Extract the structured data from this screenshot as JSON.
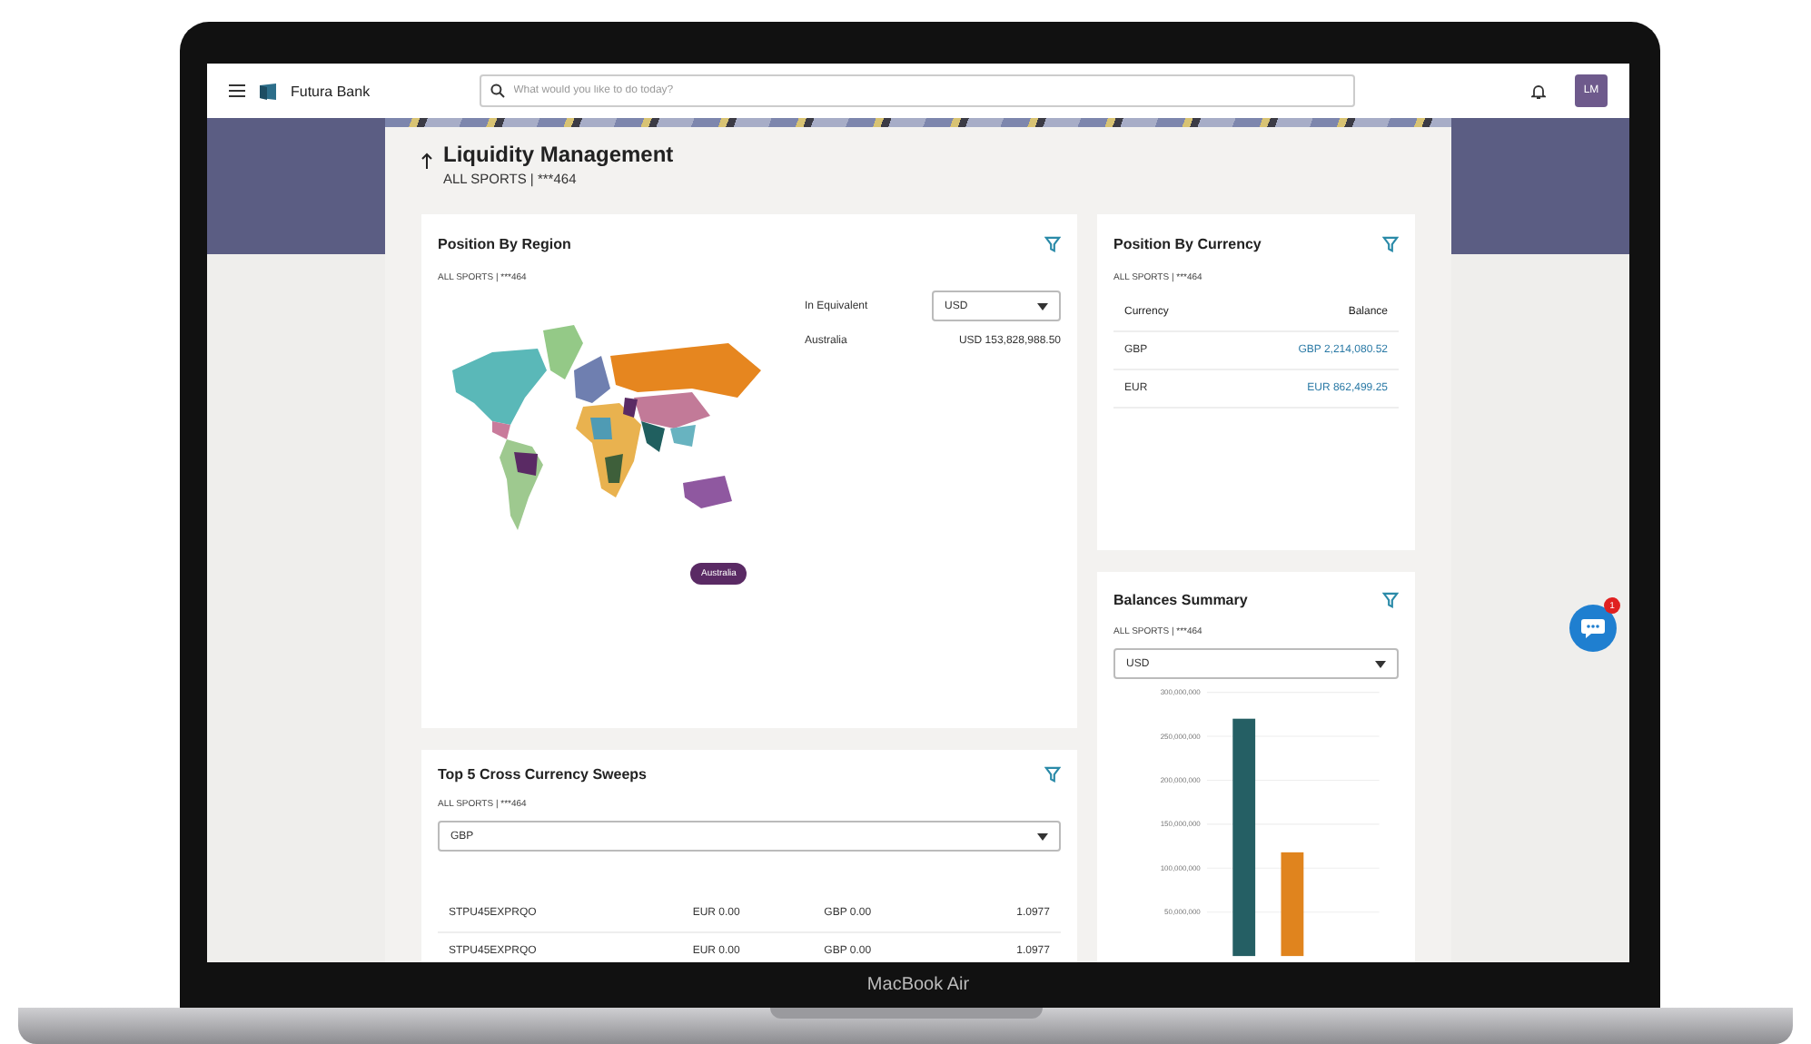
{
  "header": {
    "brand": "Futura Bank",
    "search": {
      "placeholder": "What would you like to do today?"
    },
    "avatar": "LM"
  },
  "page": {
    "title": "Liquidity Management",
    "subtitle": "ALL SPORTS | ***464"
  },
  "position_by_region": {
    "title": "Position By Region",
    "subtitle": "ALL SPORTS | ***464",
    "equivalent_label": "In Equivalent",
    "currency": "USD",
    "region": "Australia",
    "amount": "USD 153,828,988.50",
    "map_tooltip": "Australia"
  },
  "position_by_currency": {
    "title": "Position By Currency",
    "subtitle": "ALL SPORTS | ***464",
    "columns": [
      "Currency",
      "Balance"
    ],
    "rows": [
      {
        "currency": "GBP",
        "balance": "GBP 2,214,080.52"
      },
      {
        "currency": "EUR",
        "balance": "EUR 862,499.25"
      }
    ]
  },
  "balances_summary": {
    "title": "Balances Summary",
    "subtitle": "ALL SPORTS | ***464",
    "currency": "USD",
    "chart_data": {
      "type": "bar",
      "grid": true,
      "values": [
        270000000,
        118000000
      ],
      "ylim": [
        0,
        300000000
      ],
      "yticks": [
        {
          "value": 300000000,
          "label": "300,000,000"
        },
        {
          "value": 250000000,
          "label": "250,000,000"
        },
        {
          "value": 200000000,
          "label": "200,000,000"
        },
        {
          "value": 150000000,
          "label": "150,000,000"
        },
        {
          "value": 100000000,
          "label": "100,000,000"
        },
        {
          "value": 50000000,
          "label": "50,000,000"
        }
      ]
    }
  },
  "sweeps": {
    "title": "Top 5 Cross Currency Sweeps",
    "subtitle": "ALL SPORTS | ***464",
    "currency": "GBP",
    "rows": [
      {
        "reference": "STPU45EXPRQO",
        "from": "EUR 0.00",
        "to": "GBP 0.00",
        "rate": "1.0977"
      },
      {
        "reference": "STPU45EXPRQO",
        "from": "EUR 0.00",
        "to": "GBP 0.00",
        "rate": "1.0977"
      }
    ]
  },
  "chat": {
    "badge": "1"
  },
  "device": {
    "label": "MacBook Air"
  }
}
